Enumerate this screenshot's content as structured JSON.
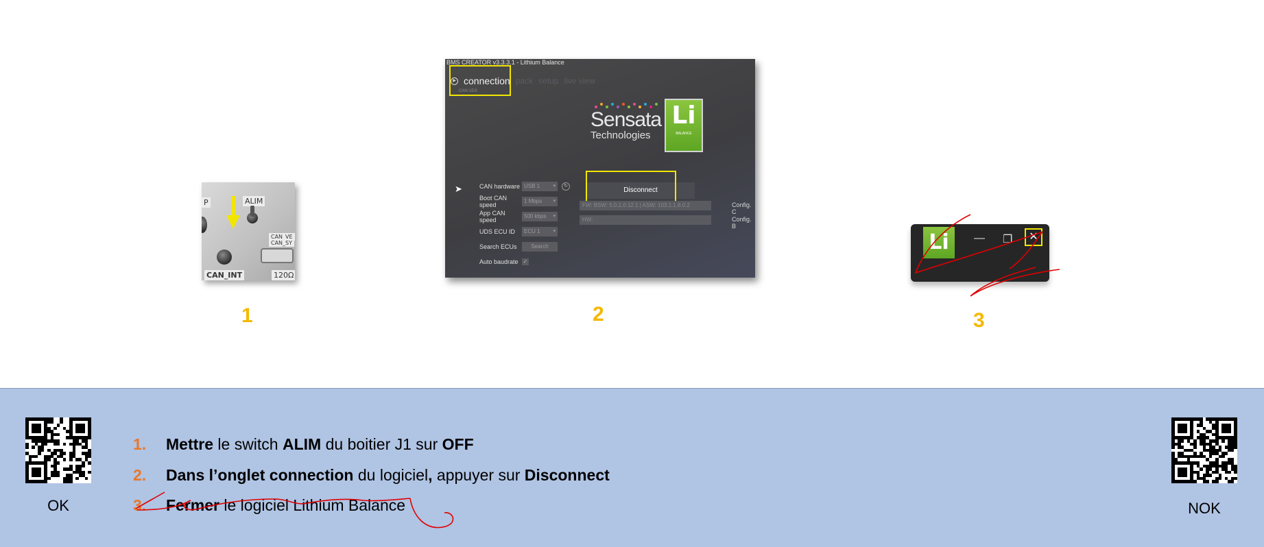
{
  "photo1": {
    "labels": {
      "alim": "ALIM",
      "can_int": "CAN_INT",
      "can_ve": "CAN_VE",
      "can_sy": "CAN_SY",
      "ohm": "120Ω",
      "p": "P"
    },
    "arrow_color": "#f2e600"
  },
  "photo2": {
    "window_title": "BMS CREATOR v3.3.3.1 - Lithium Balance",
    "tabs": {
      "active": "connection",
      "dim": [
        "pack",
        "setup",
        "live view"
      ]
    },
    "sub_label": "CAN UDS",
    "form": [
      {
        "label": "CAN hardware",
        "value": "USB 1"
      },
      {
        "label": "Boot CAN speed",
        "value": "1 Mbps"
      },
      {
        "label": "App CAN speed",
        "value": "500 kbps"
      },
      {
        "label": "UDS ECU ID",
        "value": "ECU 1"
      },
      {
        "label": "Search ECUs",
        "value": "Search"
      },
      {
        "label": "Auto baudrate",
        "value": "✓"
      }
    ],
    "logo": {
      "brand": "Sensata",
      "brand_sub": "Technologies",
      "li": "Li",
      "li_sub": "BALANCE"
    },
    "disconnect_label": "Disconnect",
    "fw_field": "FW:      BSW: 5.0.1.0.12.1 | ASW: 103.1.1.8.0.2",
    "hw_field": "HW:",
    "config_1": "Config. C",
    "config_2": "Config. B"
  },
  "photo3": {
    "li": "Li",
    "minimize": "—",
    "restore": "❐",
    "close": "✕"
  },
  "step_numbers": [
    "1",
    "2",
    "3"
  ],
  "instructions": [
    {
      "num": "1.",
      "parts": [
        {
          "text": "Mettre",
          "bold": true
        },
        {
          "text": " le switch ",
          "bold": false
        },
        {
          "text": "ALIM",
          "bold": true
        },
        {
          "text": " du boitier J1 sur ",
          "bold": false
        },
        {
          "text": "OFF",
          "bold": true
        }
      ]
    },
    {
      "num": "2.",
      "parts": [
        {
          "text": "Dans l’onglet connection",
          "bold": true
        },
        {
          "text": " du logiciel",
          "bold": false
        },
        {
          "text": ",",
          "bold": true
        },
        {
          "text": " appuyer sur ",
          "bold": false
        },
        {
          "text": "Disconnect",
          "bold": true
        }
      ]
    },
    {
      "num": "3.",
      "parts": [
        {
          "text": "Fermer",
          "bold": true
        },
        {
          "text": " le logiciel Lithium Balance",
          "bold": false
        }
      ]
    }
  ],
  "qr_ok_caption": "OK",
  "qr_nok_caption": "NOK",
  "colors": {
    "step_yellow": "#f5b800",
    "list_orange": "#e7782c",
    "band_blue": "#b0c4e4",
    "annot_red": "#e00000",
    "highlight_yellow": "#f2e600"
  }
}
